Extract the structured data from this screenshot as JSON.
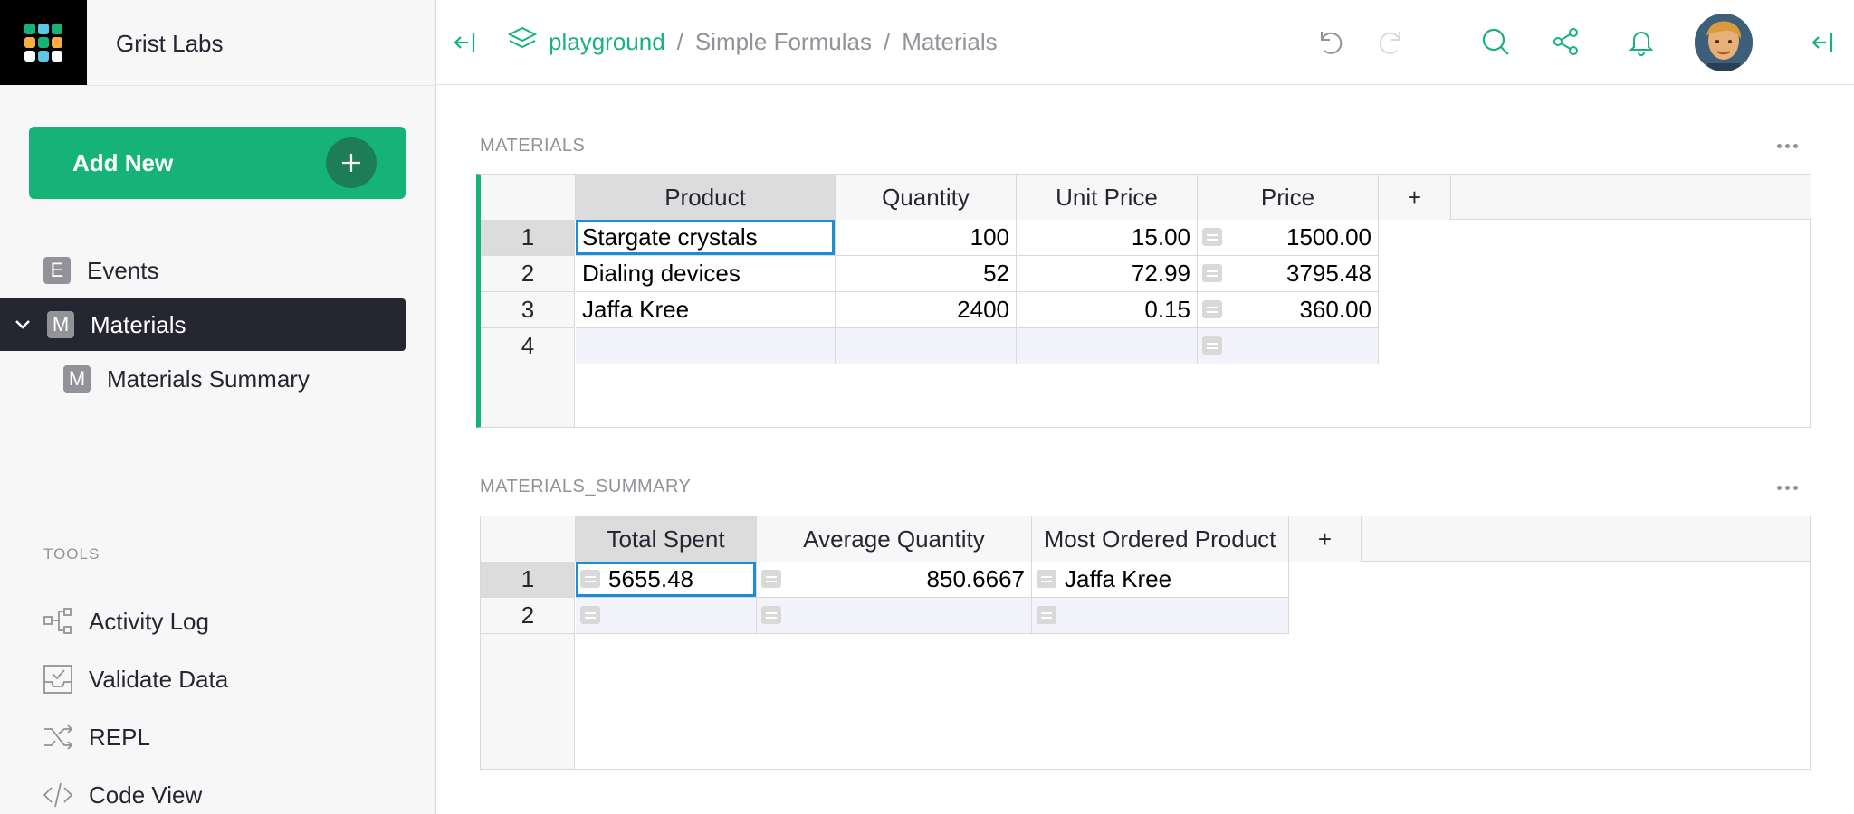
{
  "org_name": "Grist Labs",
  "add_new_label": "Add New",
  "pages": [
    {
      "icon_letter": "E",
      "label": "Events"
    },
    {
      "icon_letter": "M",
      "label": "Materials"
    },
    {
      "icon_letter": "M",
      "label": "Materials Summary"
    }
  ],
  "tools_label": "TOOLS",
  "tools": [
    {
      "icon": "activity-log-icon",
      "label": "Activity Log"
    },
    {
      "icon": "validate-data-icon",
      "label": "Validate Data"
    },
    {
      "icon": "repl-icon",
      "label": "REPL"
    },
    {
      "icon": "code-view-icon",
      "label": "Code View"
    }
  ],
  "breadcrumb": {
    "workspace": "playground",
    "separator": "/",
    "document": "Simple Formulas",
    "page": "Materials"
  },
  "materials": {
    "title": "MATERIALS",
    "columns": [
      "Product",
      "Quantity",
      "Unit Price",
      "Price",
      "+"
    ],
    "rows": [
      {
        "num": "1",
        "product": "Stargate crystals",
        "quantity": "100",
        "unit_price": "15.00",
        "price": "1500.00"
      },
      {
        "num": "2",
        "product": "Dialing devices",
        "quantity": "52",
        "unit_price": "72.99",
        "price": "3795.48"
      },
      {
        "num": "3",
        "product": "Jaffa Kree",
        "quantity": "2400",
        "unit_price": "0.15",
        "price": "360.00"
      },
      {
        "num": "4",
        "product": "",
        "quantity": "",
        "unit_price": "",
        "price": ""
      }
    ]
  },
  "summary": {
    "title": "MATERIALS_SUMMARY",
    "columns": [
      "Total Spent",
      "Average Quantity",
      "Most Ordered Product",
      "+"
    ],
    "rows": [
      {
        "num": "1",
        "total_spent": "5655.48",
        "average_quantity": "850.6667",
        "most_ordered": "Jaffa Kree"
      },
      {
        "num": "2",
        "total_spent": "",
        "average_quantity": "",
        "most_ordered": ""
      }
    ]
  },
  "colors": {
    "accent": "#16b378",
    "accent_dark": "#1d7e55",
    "active_page_bg": "#262633",
    "cursor": "#1a8fd8"
  }
}
